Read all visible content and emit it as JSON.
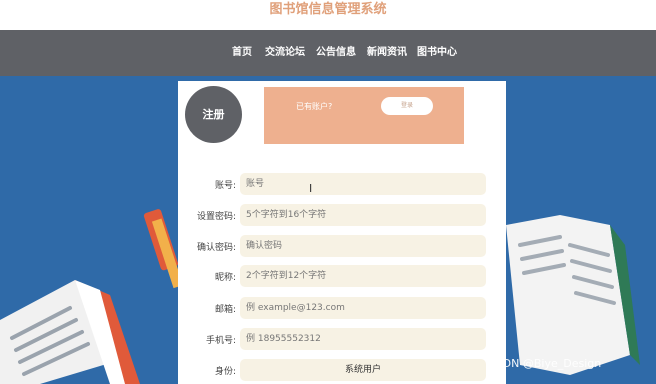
{
  "header": {
    "title": "图书馆信息管理系统"
  },
  "nav": [
    "首页",
    "交流论坛",
    "公告信息",
    "新闻资讯",
    "图书中心"
  ],
  "register": {
    "badge": "注册",
    "has_account_text": "已有账户?",
    "login_button": "登录"
  },
  "form": {
    "account": {
      "label": "账号:",
      "placeholder": "账号"
    },
    "set_password": {
      "label": "设置密码:",
      "placeholder": "5个字符到16个字符"
    },
    "confirm_password": {
      "label": "确认密码:",
      "placeholder": "确认密码"
    },
    "nickname": {
      "label": "昵称:",
      "placeholder": "2个字符到12个字符"
    },
    "email": {
      "label": "邮箱:",
      "placeholder": "例 example@123.com"
    },
    "phone": {
      "label": "手机号:",
      "placeholder": "例 18955552312"
    },
    "identity": {
      "label": "身份:",
      "value": "系统用户"
    }
  },
  "watermark": "CSDN @Biye_Design",
  "colors": {
    "background": "#2f6aa8",
    "navbar": "#5f6166",
    "title": "#e0a07a",
    "promo": "#eeb08f",
    "field": "#f7f2e4"
  },
  "icons": {
    "cursor": "text-cursor-icon"
  }
}
